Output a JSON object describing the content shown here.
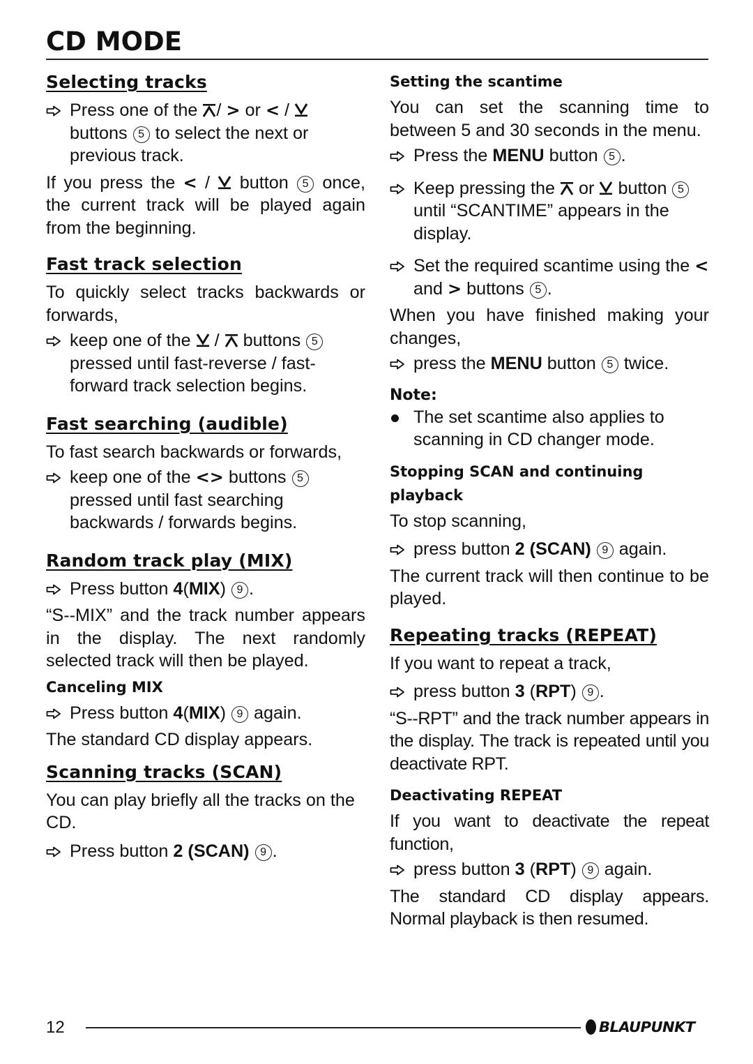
{
  "header": {
    "title": "CD MODE"
  },
  "left": {
    "selecting": {
      "heading": "Selecting tracks",
      "step1": {
        "pre": "Press one of the",
        "slash1": "/",
        "or": "or",
        "slash2": "/",
        "mid": "buttons",
        "circ": "5",
        "post": "to select the next or previous track."
      },
      "para": {
        "pre": "If you press the",
        "slash": "/",
        "mid": "button",
        "circ": "5",
        "post": "once, the current track will be played again from the beginning."
      }
    },
    "fast_track": {
      "heading": "Fast track selection",
      "intro": "To quickly select tracks backwards or forwards,",
      "step": {
        "pre": "keep one of the",
        "slash": "/",
        "mid": "buttons",
        "circ": "5",
        "post": "pressed until fast-reverse / fast-forward track selection begins."
      }
    },
    "fast_search": {
      "heading": "Fast searching (audible)",
      "intro": "To fast search backwards or forwards,",
      "step": {
        "pre": "keep one of the",
        "mid": "buttons",
        "circ": "5",
        "post": "pressed until fast searching backwards / forwards begins."
      }
    },
    "mix": {
      "heading": "Random track play (MIX)",
      "step": {
        "pre": "Press button",
        "num": "4",
        "open": "(",
        "label": "MIX",
        "close": ")",
        "circ": "9",
        "post": "."
      },
      "para": "“S--MIX” and the track number appears in the display. The next randomly selected track will then be played.",
      "cancel_heading": "Canceling MIX",
      "cancel_step": {
        "pre": "Press button",
        "num": "4",
        "open": "(",
        "label": "MIX",
        "close": ")",
        "circ": "9",
        "post": "again."
      },
      "cancel_para": "The standard CD display appears."
    },
    "scan": {
      "heading": "Scanning tracks (SCAN)",
      "intro": "You can play briefly all the tracks on the CD.",
      "step": {
        "pre": "Press button",
        "label": "2 (SCAN)",
        "circ": "9",
        "post": "."
      }
    }
  },
  "right": {
    "scantime": {
      "heading": "Setting the scantime",
      "intro": "You can set the scanning time to between 5 and 30 seconds in the menu.",
      "step1": {
        "pre": "Press the",
        "label": "MENU",
        "mid": "button",
        "circ": "5",
        "post": "."
      },
      "step2": {
        "pre": "Keep pressing the",
        "or": "or",
        "mid": "button",
        "circ": "5",
        "post": "until “SCANTIME” appears in the display."
      },
      "step3": {
        "pre": "Set the required scantime using the",
        "and": "and",
        "mid": "buttons",
        "circ": "5",
        "post": "."
      },
      "para": "When you have finished making your changes,",
      "step4": {
        "pre": "press the",
        "label": "MENU",
        "mid": "button",
        "circ": "5",
        "post": "twice."
      }
    },
    "note": {
      "heading": "Note:",
      "bullet": "The set scantime also applies to scanning in CD changer mode."
    },
    "stop_scan": {
      "heading": "Stopping SCAN and continuing playback",
      "intro": "To stop scanning,",
      "step": {
        "pre": "press button",
        "label": "2 (SCAN)",
        "circ": "9",
        "post": "again."
      },
      "para": "The current track will then continue to be played."
    },
    "repeat": {
      "heading": "Repeating tracks (REPEAT)",
      "intro": "If you want to repeat a track,",
      "step": {
        "pre": "press button",
        "num": "3",
        "open": "(",
        "label": "RPT",
        "close": ")",
        "circ": "9",
        "post": "."
      },
      "para": "“S--RPT” and the track number appears in the display. The track is repeated until you deactivate RPT.",
      "deact_heading": "Deactivating REPEAT",
      "deact_intro": "If you want to deactivate the repeat function,",
      "deact_step": {
        "pre": "press button",
        "num": "3",
        "open": "(",
        "label": "RPT",
        "close": ")",
        "circ": "9",
        "post": "again."
      },
      "deact_para": "The standard CD display appears. Normal playback is then resumed."
    }
  },
  "footer": {
    "page_number": "12",
    "brand": "BLAUPUNKT"
  },
  "symbols": {
    "left": "<",
    "right": ">"
  }
}
